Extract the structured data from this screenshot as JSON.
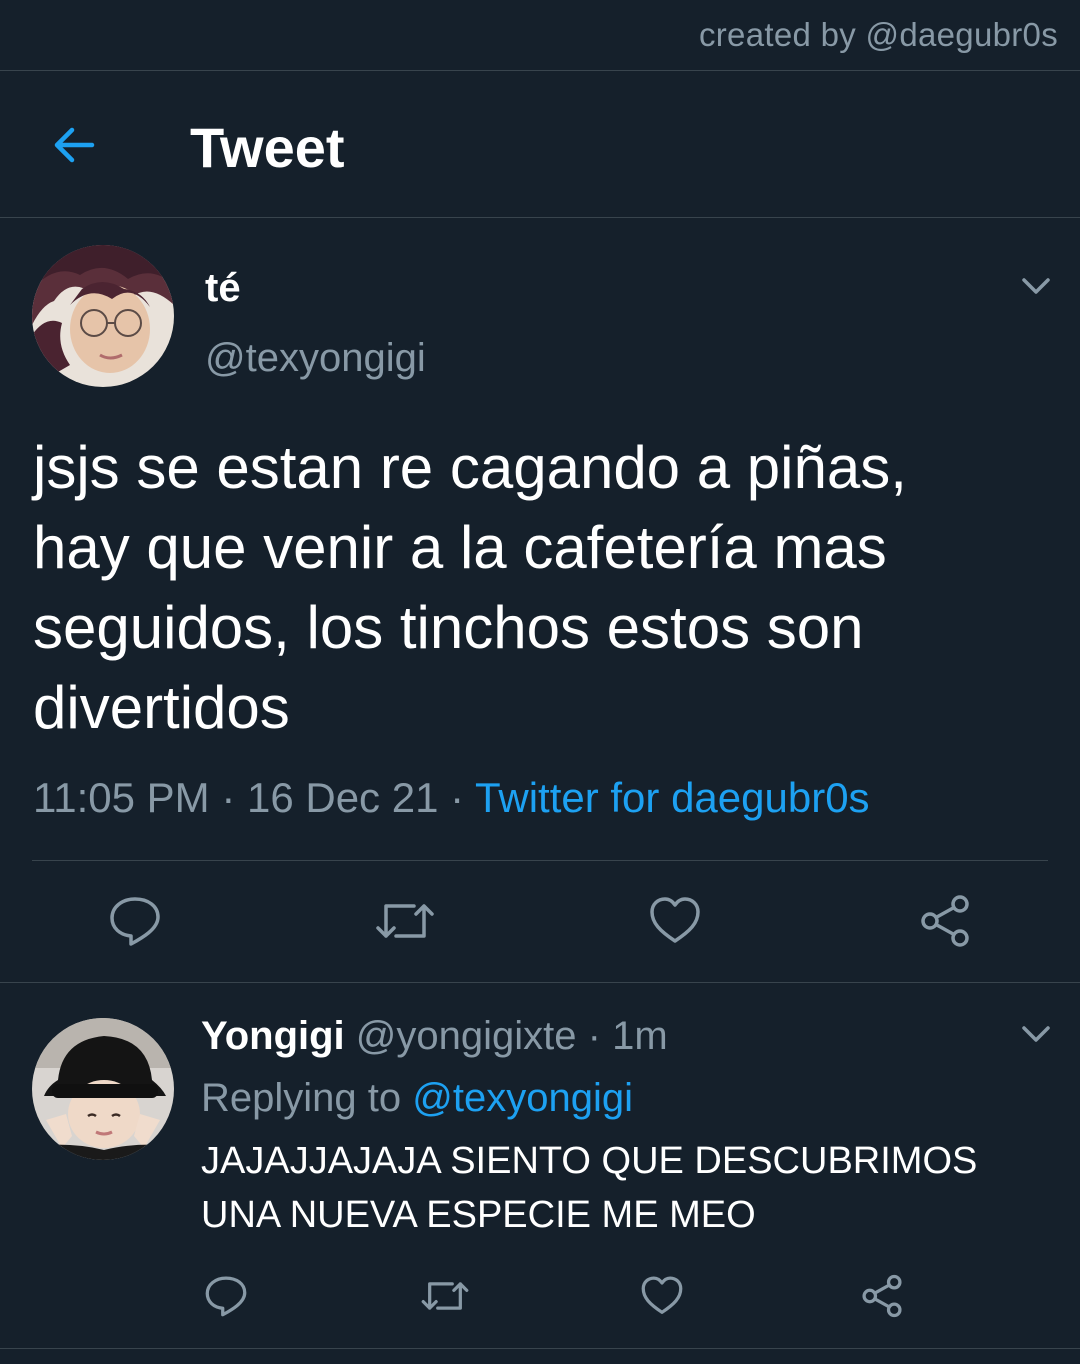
{
  "credit": "created by @daegubr0s",
  "header": {
    "title": "Tweet",
    "back_icon": "arrow-left-icon"
  },
  "tweet": {
    "display_name": "té",
    "handle": "@texyongigi",
    "text_lines": [
      "jsjs se estan re cagando a piñas,",
      "hay que venir a la cafetería mas",
      "seguidos, los tinchos estos son",
      "divertidos"
    ],
    "time": "11:05 PM",
    "separator": " · ",
    "date": "16 Dec 21",
    "source": "Twitter for daegubr0s",
    "actions": [
      "reply-icon",
      "retweet-icon",
      "like-icon",
      "share-icon"
    ]
  },
  "reply": {
    "display_name": "Yongigi",
    "handle": "@yongigixte",
    "separator": " · ",
    "time": "1m",
    "replying_prefix": "Replying to ",
    "replying_to": "@texyongigi",
    "text_lines": [
      "JAJAJJAJAJA SIENTO QUE DESCUBRIMOS",
      "UNA NUEVA ESPECIE ME MEO"
    ],
    "actions": [
      "reply-icon",
      "retweet-icon",
      "like-icon",
      "share-icon"
    ]
  },
  "colors": {
    "background": "#15202b",
    "accent": "#1da1f2",
    "secondary_text": "#8899a6",
    "divider": "#38444d"
  }
}
